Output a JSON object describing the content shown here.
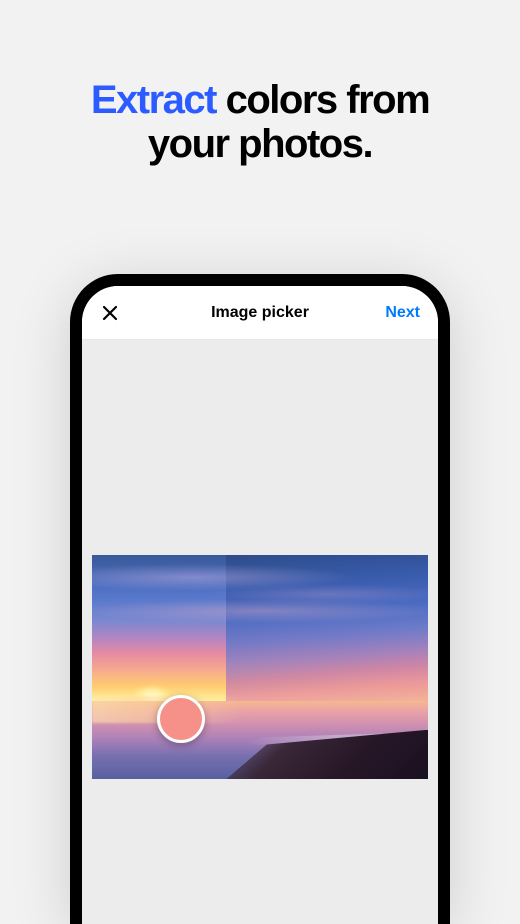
{
  "promo": {
    "highlight_word": "Extract",
    "line1_rest": " colors from",
    "line2": "your photos."
  },
  "screen": {
    "nav": {
      "title": "Image picker",
      "next_label": "Next"
    },
    "picker": {
      "selected_color": "#f59188"
    }
  }
}
